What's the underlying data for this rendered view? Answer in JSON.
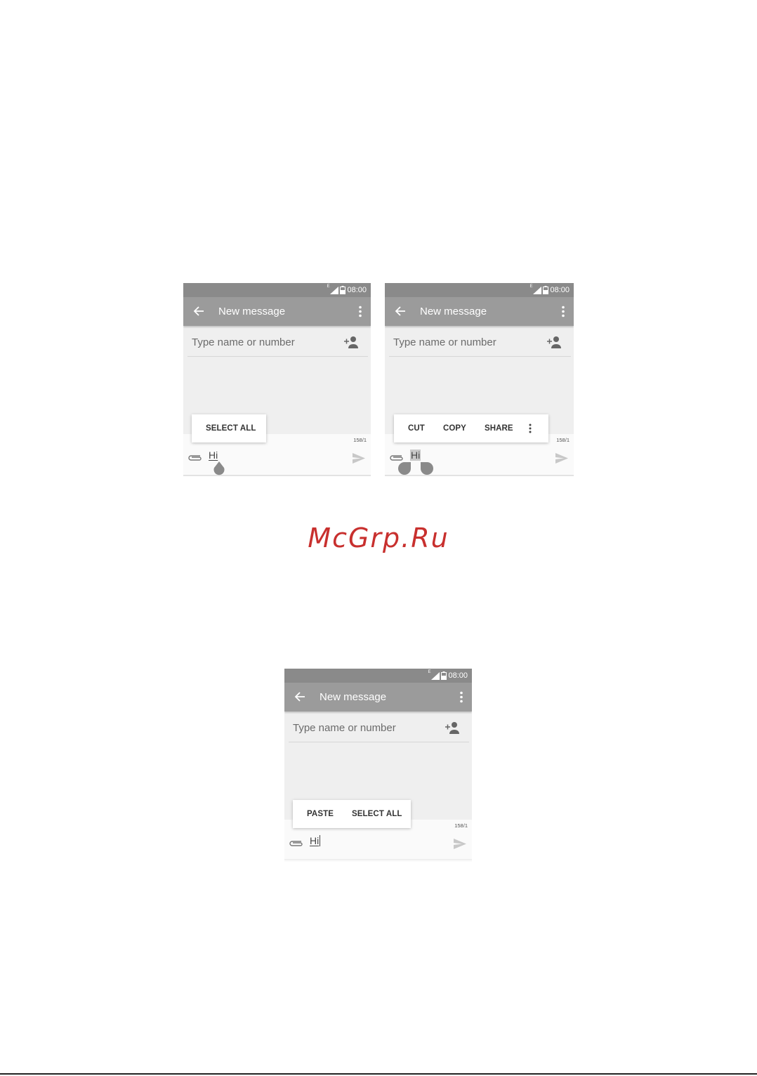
{
  "screens": [
    {
      "status": {
        "network": "E",
        "time": "08:00"
      },
      "appbar": {
        "title": "New message"
      },
      "recipient": {
        "placeholder": "Type name or number"
      },
      "compose": {
        "counter": "158/1",
        "text": "Hi"
      },
      "popup": {
        "items": [
          "SELECT ALL"
        ]
      }
    },
    {
      "status": {
        "network": "E",
        "time": "08:00"
      },
      "appbar": {
        "title": "New message"
      },
      "recipient": {
        "placeholder": "Type name or number"
      },
      "compose": {
        "counter": "158/1",
        "text": "Hi"
      },
      "popup": {
        "items": [
          "CUT",
          "COPY",
          "SHARE"
        ]
      }
    },
    {
      "status": {
        "network": "E",
        "time": "08:00"
      },
      "appbar": {
        "title": "New message"
      },
      "recipient": {
        "placeholder": "Type name or number"
      },
      "compose": {
        "counter": "158/1",
        "text": "Hi"
      },
      "popup": {
        "items": [
          "PASTE",
          "SELECT ALL"
        ]
      }
    }
  ],
  "watermark": "McGrp.Ru",
  "colors": {
    "statusbar": "#8a8a8a",
    "appbar": "#9b9b9b",
    "background": "#efefef",
    "watermark": "#c8302e"
  }
}
